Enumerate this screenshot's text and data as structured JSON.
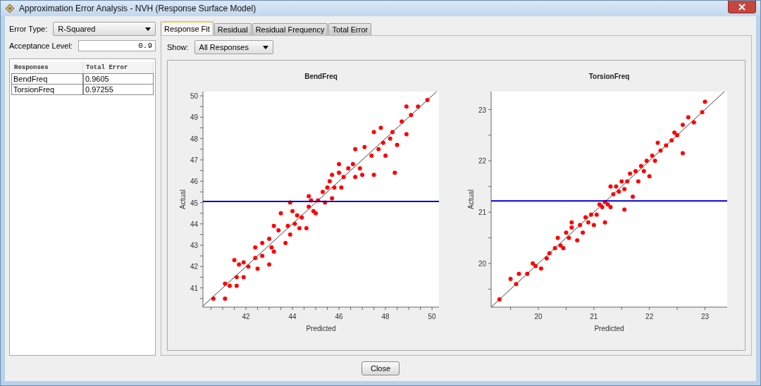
{
  "window": {
    "title": "Approximation Error Analysis - NVH (Response Surface Model)"
  },
  "left_panel": {
    "error_type": {
      "label": "Error Type:",
      "value": "R-Squared"
    },
    "acceptance_level": {
      "label": "Acceptance Level:",
      "value": "0.9"
    },
    "table": {
      "columns": [
        "Responses",
        "Total Error"
      ],
      "rows": [
        {
          "cells": [
            "BendFreq",
            "0.9605"
          ]
        },
        {
          "cells": [
            "TorsionFreq",
            "0.97255"
          ]
        }
      ]
    }
  },
  "tabs": [
    {
      "label": "Response Fit",
      "selected": true
    },
    {
      "label": "Residual",
      "selected": false
    },
    {
      "label": "Residual Frequency",
      "selected": false
    },
    {
      "label": "Total Error",
      "selected": false
    }
  ],
  "show": {
    "label": "Show:",
    "value": "All Responses"
  },
  "charts": [
    {
      "chart_data": {
        "type": "scatter",
        "title": "BendFreq",
        "xlabel": "Predicted",
        "ylabel": "Actual",
        "xlim": [
          40.15,
          50.3
        ],
        "ylim": [
          40.1,
          50.2
        ],
        "xticks": [
          42,
          44,
          46,
          48,
          50
        ],
        "yticks": [
          41,
          42,
          43,
          44,
          45,
          46,
          47,
          48,
          49,
          50
        ],
        "series": [
          {
            "color": "#ff0000",
            "x": [
              40.6,
              41.1,
              41.1,
              41.3,
              41.5,
              41.6,
              41.6,
              41.7,
              41.9,
              41.9,
              42.1,
              42.4,
              42.4,
              42.5,
              42.7,
              42.7,
              43.0,
              43.0,
              43.1,
              43.2,
              43.2,
              43.4,
              43.5,
              43.7,
              43.8,
              43.9,
              43.9,
              44.0,
              44.1,
              44.2,
              44.3,
              44.4,
              44.6,
              44.7,
              44.7,
              44.8,
              44.9,
              45.0,
              45.1,
              45.3,
              45.4,
              45.5,
              45.6,
              45.7,
              45.7,
              45.8,
              46.0,
              46.0,
              46.1,
              46.2,
              46.4,
              46.6,
              46.7,
              46.7,
              46.9,
              47.0,
              47.1,
              47.4,
              47.5,
              47.5,
              47.7,
              47.8,
              47.9,
              48.0,
              48.2,
              48.3,
              48.4,
              48.5,
              48.7,
              48.9,
              48.9,
              49.1,
              49.4,
              49.8
            ],
            "values": [
              40.5,
              41.2,
              40.5,
              41.1,
              42.3,
              41.5,
              41.1,
              42.1,
              41.5,
              42.2,
              42.0,
              42.9,
              42.4,
              41.9,
              43.1,
              42.5,
              42.1,
              43.3,
              42.9,
              43.9,
              42.7,
              43.7,
              44.5,
              43.1,
              43.9,
              45.0,
              43.5,
              44.6,
              44.0,
              44.4,
              43.8,
              44.3,
              43.8,
              45.3,
              44.8,
              45.1,
              44.6,
              44.5,
              45.1,
              45.5,
              45.0,
              45.7,
              46.0,
              45.2,
              46.3,
              45.7,
              46.4,
              46.8,
              45.7,
              46.2,
              46.6,
              46.8,
              47.5,
              46.2,
              46.6,
              46.3,
              47.6,
              47.2,
              48.3,
              46.3,
              47.5,
              48.5,
              47.8,
              47.2,
              48.0,
              48.3,
              46.4,
              47.7,
              48.8,
              49.5,
              48.2,
              49.1,
              49.5,
              49.8
            ]
          },
          {
            "type": "line",
            "color": "#404040",
            "x": [
              40.15,
              50.2
            ],
            "values": [
              40.15,
              50.2
            ]
          }
        ],
        "ref_lines": [
          {
            "axis": "y",
            "value": 45.05,
            "color": "#0000cc"
          }
        ]
      }
    },
    {
      "chart_data": {
        "type": "scatter",
        "title": "TorsionFreq",
        "xlabel": "Predicted",
        "ylabel": "Actual",
        "xlim": [
          19.15,
          23.4
        ],
        "ylim": [
          19.15,
          23.35
        ],
        "xticks": [
          20,
          21,
          22,
          23
        ],
        "yticks": [
          20,
          21,
          22,
          23
        ],
        "series": [
          {
            "color": "#ff0000",
            "x": [
              19.3,
              19.5,
              19.6,
              19.65,
              19.8,
              19.9,
              19.95,
              20.05,
              20.15,
              20.2,
              20.3,
              20.35,
              20.4,
              20.45,
              20.5,
              20.55,
              20.6,
              20.6,
              20.7,
              20.75,
              20.8,
              20.85,
              20.9,
              20.95,
              21.0,
              21.05,
              21.1,
              21.15,
              21.2,
              21.2,
              21.25,
              21.3,
              21.3,
              21.35,
              21.4,
              21.45,
              21.5,
              21.55,
              21.55,
              21.6,
              21.65,
              21.7,
              21.75,
              21.8,
              21.85,
              21.9,
              21.95,
              22.0,
              22.05,
              22.1,
              22.15,
              22.2,
              22.3,
              22.4,
              22.45,
              22.5,
              22.6,
              22.6,
              22.7,
              22.8,
              22.95,
              23.0
            ],
            "values": [
              19.3,
              19.7,
              19.6,
              19.8,
              19.8,
              20.0,
              19.95,
              19.9,
              20.1,
              20.2,
              20.3,
              20.5,
              20.35,
              20.3,
              20.6,
              20.5,
              20.7,
              20.8,
              20.45,
              20.75,
              20.6,
              20.9,
              20.8,
              20.95,
              20.75,
              20.95,
              21.15,
              21.1,
              20.8,
              21.2,
              21.15,
              21.5,
              21.1,
              21.35,
              21.5,
              21.4,
              21.6,
              21.05,
              21.45,
              21.6,
              21.75,
              21.3,
              21.8,
              21.6,
              21.9,
              21.8,
              22.0,
              21.7,
              22.1,
              22.0,
              22.35,
              22.2,
              22.3,
              22.4,
              22.55,
              22.5,
              22.7,
              22.15,
              22.85,
              22.75,
              22.95,
              23.15
            ]
          },
          {
            "type": "line",
            "color": "#404040",
            "x": [
              19.15,
              23.35
            ],
            "values": [
              19.15,
              23.35
            ]
          }
        ],
        "ref_lines": [
          {
            "axis": "y",
            "value": 21.22,
            "color": "#0000cc"
          }
        ]
      }
    }
  ],
  "buttons": [
    {
      "label": "Close"
    }
  ]
}
